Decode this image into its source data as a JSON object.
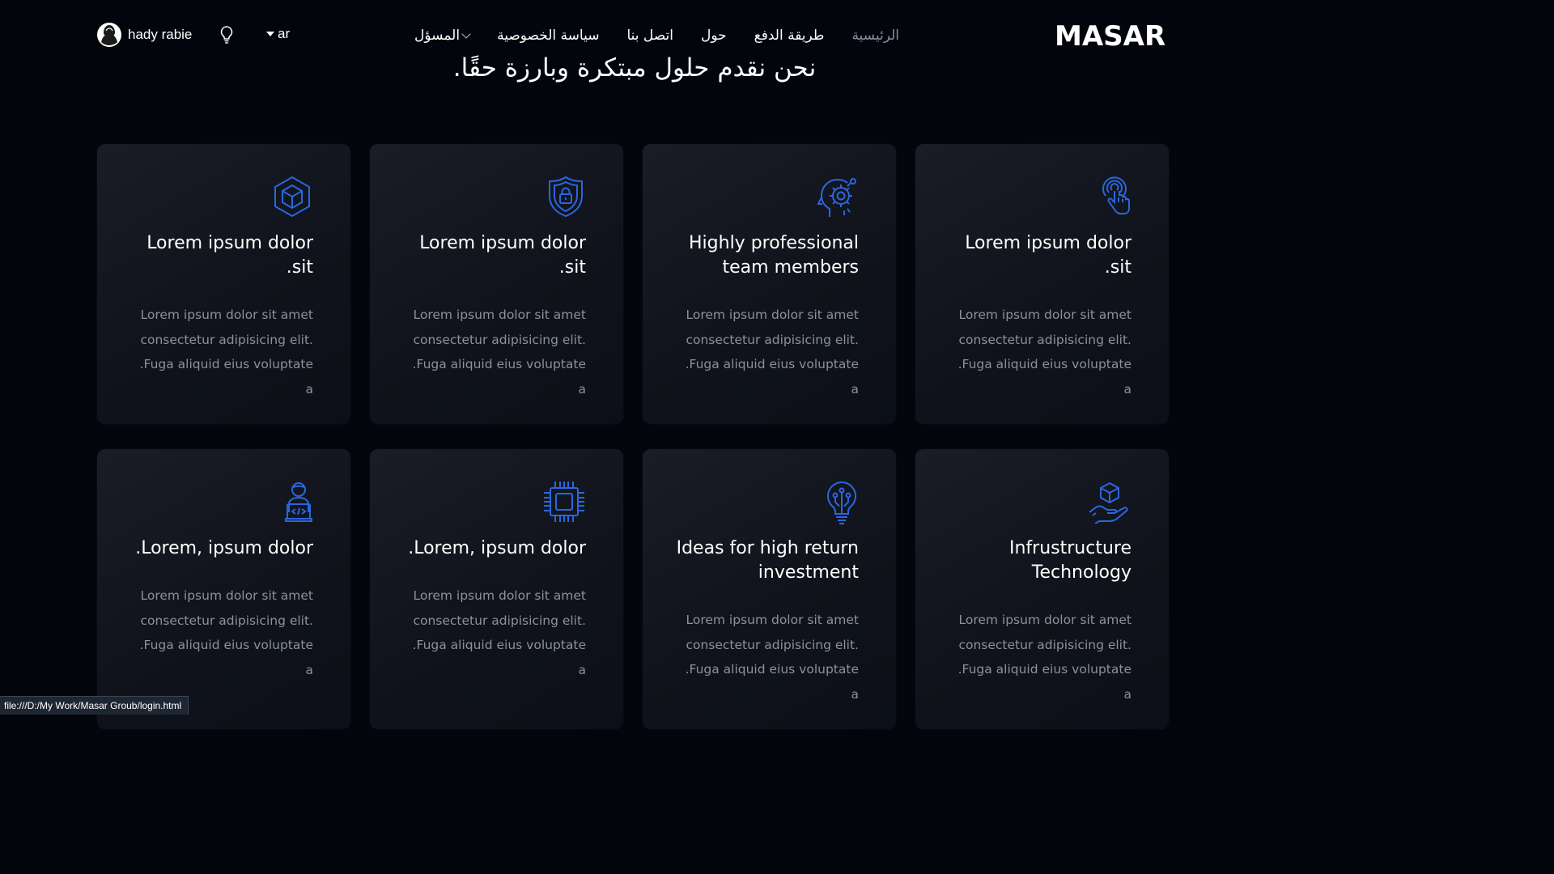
{
  "brand": {
    "logo_text": "MASAR"
  },
  "nav": {
    "items": [
      {
        "label": "الرئيسية",
        "active": true
      },
      {
        "label": "طريقة الدفع"
      },
      {
        "label": "حول"
      },
      {
        "label": "اتصل بنا"
      },
      {
        "label": "سياسة الخصوصية"
      },
      {
        "label": "المسؤل",
        "dropdown": true
      }
    ],
    "language": "ar",
    "user_name": "hady rabie"
  },
  "hero": {
    "headline": "نحن نقدم حلول مبتكرة وبارزة حقًا."
  },
  "cards": [
    {
      "icon": "cube-hexagon-icon",
      "title": "Lorem ipsum dolor .sit",
      "desc": [
        "Lorem ipsum dolor sit amet",
        "consectetur adipisicing elit.",
        ".Fuga aliquid eius voluptate a"
      ]
    },
    {
      "icon": "shield-lock-icon",
      "title": "Lorem ipsum dolor .sit",
      "desc": [
        "Lorem ipsum dolor sit amet",
        "consectetur adipisicing elit.",
        ".Fuga aliquid eius voluptate a"
      ]
    },
    {
      "icon": "head-gear-icon",
      "title": "Highly professional team members",
      "desc": [
        "Lorem ipsum dolor sit amet",
        "consectetur adipisicing elit.",
        ".Fuga aliquid eius voluptate a"
      ]
    },
    {
      "icon": "fingerprint-touch-icon",
      "title": "Lorem ipsum dolor .sit",
      "desc": [
        "Lorem ipsum dolor sit amet",
        "consectetur adipisicing elit.",
        ".Fuga aliquid eius voluptate a"
      ]
    },
    {
      "icon": "developer-icon",
      "title": ".Lorem, ipsum dolor",
      "desc": [
        "Lorem ipsum dolor sit amet",
        "consectetur adipisicing elit.",
        ".Fuga aliquid eius voluptate a"
      ]
    },
    {
      "icon": "chip-icon",
      "title": ".Lorem, ipsum dolor",
      "desc": [
        "Lorem ipsum dolor sit amet",
        "consectetur adipisicing elit.",
        ".Fuga aliquid eius voluptate a"
      ]
    },
    {
      "icon": "lightbulb-circuit-icon",
      "title": "Ideas for high return investment",
      "desc": [
        "Lorem ipsum dolor sit amet",
        "consectetur adipisicing elit.",
        ".Fuga aliquid eius voluptate a"
      ]
    },
    {
      "icon": "hand-cube-icon",
      "title": "Infrustructure Technology",
      "desc": [
        "Lorem ipsum dolor sit amet",
        "consectetur adipisicing elit.",
        ".Fuga aliquid eius voluptate a"
      ]
    }
  ],
  "status_bar": {
    "url": "file:///D:/My Work/Masar Groub/login.html"
  },
  "colors": {
    "background": "#03050d",
    "card": "#141720",
    "accent_icon": "#2a66e0",
    "muted_text": "#8d919c"
  }
}
